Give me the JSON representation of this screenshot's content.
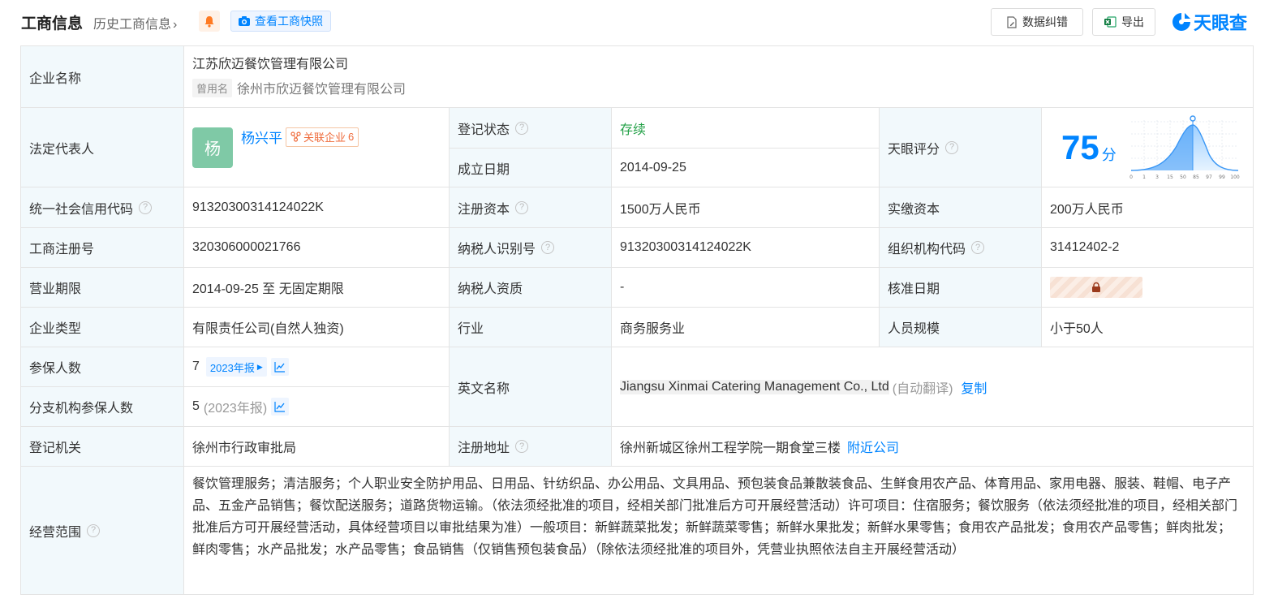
{
  "header": {
    "title": "工商信息",
    "history_link": "历史工商信息",
    "snapshot_button": "查看工商快照",
    "correct_button": "数据纠错",
    "export_button": "导出",
    "logo": "天眼查"
  },
  "company": {
    "name_label": "企业名称",
    "name": "江苏欣迈餐饮管理有限公司",
    "former_tag": "曾用名",
    "former_name": "徐州市欣迈餐饮管理有限公司",
    "legal_rep_label": "法定代表人",
    "legal_rep_avatar": "杨",
    "legal_rep": "杨兴平",
    "related_label": "关联企业",
    "related_count": "6",
    "reg_status_label": "登记状态",
    "reg_status": "存续",
    "found_date_label": "成立日期",
    "found_date": "2014-09-25",
    "score_label": "天眼评分",
    "score_value": "75",
    "score_unit": "分",
    "score_ticks": [
      "0",
      "1",
      "3",
      "15",
      "50",
      "85",
      "97",
      "99",
      "100"
    ],
    "credit_code_label": "统一社会信用代码",
    "credit_code": "91320300314124022K",
    "reg_capital_label": "注册资本",
    "reg_capital": "1500万人民币",
    "paid_capital_label": "实缴资本",
    "paid_capital": "200万人民币",
    "reg_no_label": "工商注册号",
    "reg_no": "320306000021766",
    "taxpayer_id_label": "纳税人识别号",
    "taxpayer_id": "91320300314124022K",
    "org_code_label": "组织机构代码",
    "org_code": "31412402-2",
    "term_label": "营业期限",
    "term": "2014-09-25 至 无固定期限",
    "tax_qual_label": "纳税人资质",
    "tax_qual": "-",
    "approve_date_label": "核准日期",
    "type_label": "企业类型",
    "type": "有限责任公司(自然人独资)",
    "industry_label": "行业",
    "industry": "商务服务业",
    "staff_label": "人员规模",
    "staff": "小于50人",
    "insured_label": "参保人数",
    "insured": "7",
    "insured_report": "2023年报",
    "branch_insured_label": "分支机构参保人数",
    "branch_insured": "5",
    "branch_insured_year": "(2023年报)",
    "english_label": "英文名称",
    "english_name": "Jiangsu Xinmai Catering Management Co., Ltd",
    "auto_translate": "(自动翻译)",
    "copy_link": "复制",
    "authority_label": "登记机关",
    "authority": "徐州市行政审批局",
    "address_label": "注册地址",
    "address": "徐州新城区徐州工程学院一期食堂三楼",
    "nearby_link": "附近公司",
    "scope_label": "经营范围",
    "scope": "餐饮管理服务；清洁服务；个人职业安全防护用品、日用品、针纺织品、办公用品、文具用品、预包装食品兼散装食品、生鲜食用农产品、体育用品、家用电器、服装、鞋帽、电子产品、五金产品销售；餐饮配送服务；道路货物运输。（依法须经批准的项目，经相关部门批准后方可开展经营活动）许可项目：住宿服务；餐饮服务（依法须经批准的项目，经相关部门批准后方可开展经营活动，具体经营项目以审批结果为准）一般项目：新鲜蔬菜批发；新鲜蔬菜零售；新鲜水果批发；新鲜水果零售；食用农产品批发；食用农产品零售；鲜肉批发；鲜肉零售；水产品批发；水产品零售；食品销售（仅销售预包装食品）（除依法须经批准的项目外，凭营业执照依法自主开展经营活动）"
  },
  "colors": {
    "accent": "#0084ff",
    "label_bg": "#f2f9fc",
    "status_green": "#24a148",
    "related_orange": "#ef6b3b"
  }
}
